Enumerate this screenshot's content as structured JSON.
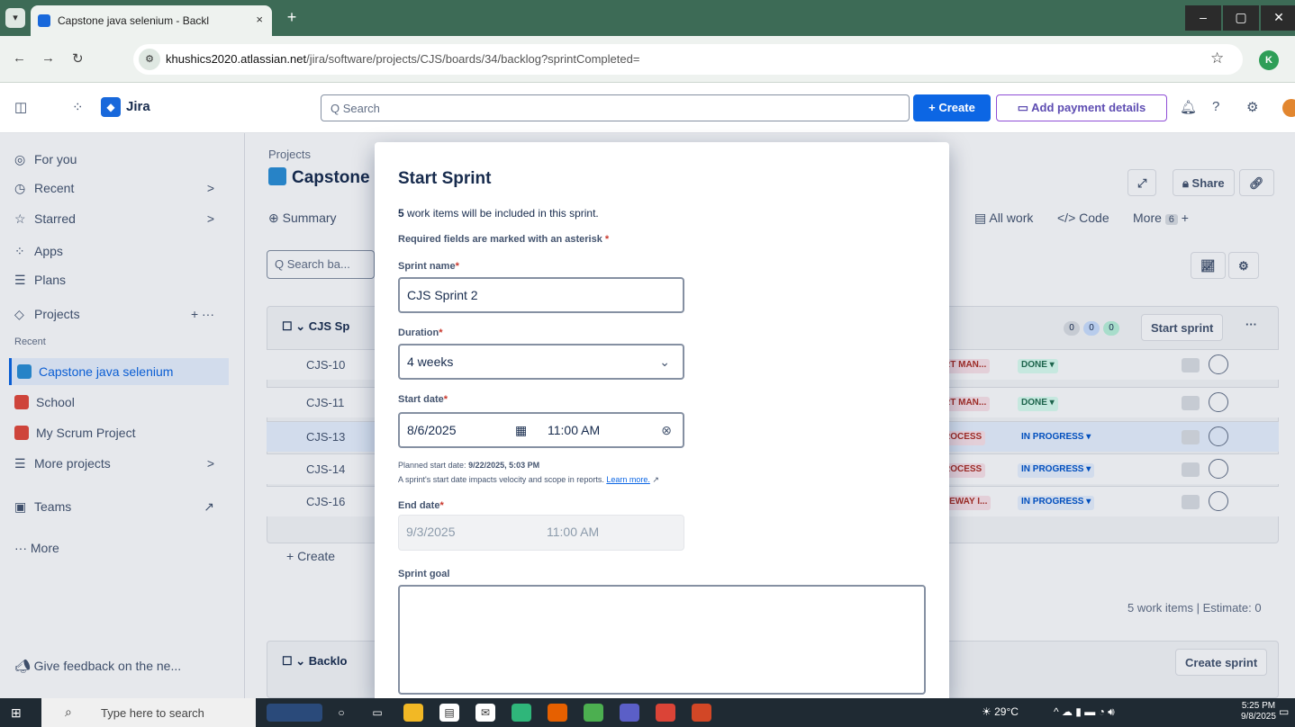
{
  "browser": {
    "tab_title": "Capstone java selenium - Backl",
    "tab_close": "×",
    "new_tab": "+",
    "url_domain": "khushics2020.atlassian.net",
    "url_path": "/jira/software/projects/CJS/boards/34/backlog?sprintCompleted=",
    "profile_initial": "K",
    "minimize": "–",
    "maximize": "▢",
    "close": "✕"
  },
  "topnav": {
    "product": "Jira",
    "search_placeholder": "Q  Search",
    "create": "+ Create",
    "add_payment": "▭  Add payment details"
  },
  "sidebar": {
    "items": [
      {
        "icon": "◎",
        "label": "For you"
      },
      {
        "icon": "◷",
        "label": "Recent",
        "chev": ">"
      },
      {
        "icon": "☆",
        "label": "Starred",
        "chev": ">"
      },
      {
        "icon": "⁘",
        "label": "Apps"
      },
      {
        "icon": "☰",
        "label": "Plans"
      },
      {
        "icon": "◇",
        "label": "Projects",
        "chev": "+ ···"
      }
    ],
    "recent_label": "Recent",
    "projects": [
      {
        "label": "Capstone java selenium",
        "color": "#2b8fd6"
      },
      {
        "label": "School",
        "color": "#e5493a"
      },
      {
        "label": "My Scrum Project",
        "color": "#e5493a"
      }
    ],
    "more_projects": "More projects",
    "teams": "Teams",
    "more": "··· More",
    "feedback": "Give feedback on the ne..."
  },
  "main": {
    "breadcrumb": "Projects",
    "project_title": "Capstone",
    "tabs": [
      "Summary",
      "All work",
      "Code",
      "More"
    ],
    "more_count": "6",
    "share": "Share",
    "search_placeholder": "Q  Search ba...",
    "sprint_header": "CJS Sp",
    "start_sprint": "Start sprint",
    "rows": [
      {
        "key": "CJS-10",
        "epic": "RT MAN...",
        "status": "DONE ▾",
        "type": "done",
        "hl": false
      },
      {
        "key": "CJS-11",
        "epic": "RT MAN...",
        "status": "DONE ▾",
        "type": "done",
        "hl": false
      },
      {
        "key": "CJS-13",
        "epic": "ROCESS",
        "status": "IN PROGRESS ▾",
        "type": "inprog",
        "hl": true
      },
      {
        "key": "CJS-14",
        "epic": "ROCESS",
        "status": "IN PROGRESS ▾",
        "type": "inprog",
        "hl": false
      },
      {
        "key": "CJS-16",
        "epic": "TEWAY I...",
        "status": "IN PROGRESS ▾",
        "type": "inprog",
        "hl": false
      }
    ],
    "create": "+ Create",
    "work_items_summary": "5 work items",
    "estimate": "Estimate: 0",
    "backlog_header": "Backlo",
    "create_sprint": "Create sprint",
    "counts": [
      "0",
      "0",
      "0"
    ]
  },
  "modal": {
    "title": "Start Sprint",
    "included_count": "5",
    "included_text": " work items will be included in this sprint.",
    "required_note": "Required fields are marked with an asterisk",
    "asterisk": "*",
    "sprint_name_label": "Sprint name",
    "sprint_name_value": "CJS Sprint 2",
    "duration_label": "Duration",
    "duration_value": "4 weeks",
    "start_date_label": "Start date",
    "start_date_value": "8/6/2025",
    "start_time_value": "11:00 AM",
    "planned_prefix": "Planned start date: ",
    "planned_value": "9/22/2025, 5:03 PM",
    "velocity_hint": "A sprint's start date impacts velocity and scope in reports. ",
    "learn_more": "Learn more.",
    "end_date_label": "End date",
    "end_date_value": "9/3/2025",
    "end_time_value": "11:00 AM",
    "sprint_goal_label": "Sprint goal"
  },
  "taskbar": {
    "search_placeholder": "Type here to search",
    "weather": "29°C",
    "time": "5:25 PM",
    "date": "9/8/2025"
  }
}
